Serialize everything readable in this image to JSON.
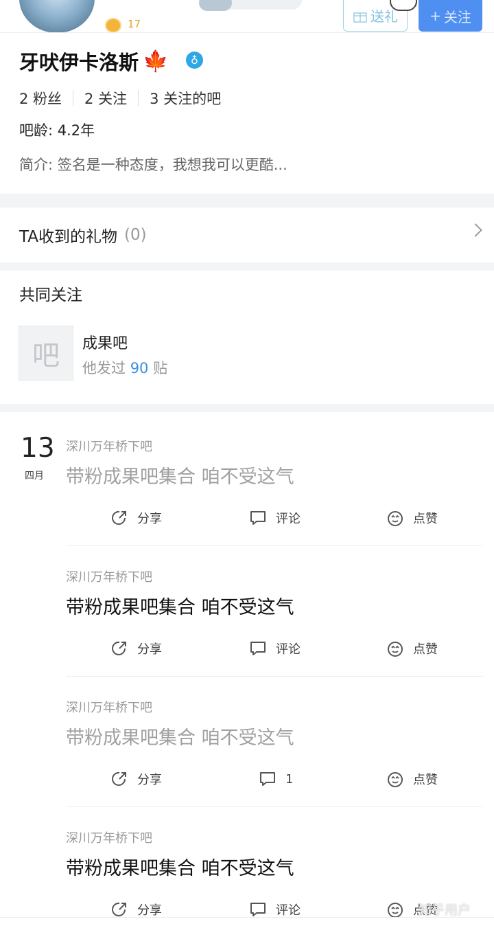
{
  "header": {
    "level": "17",
    "gift_label": "送礼",
    "follow_label": "关注",
    "follow_plus": "+"
  },
  "profile": {
    "username": "牙吠伊卡洛斯",
    "badge_emoji": "🍁",
    "verify_symbol": "♁",
    "stats": [
      {
        "label": "2 粉丝"
      },
      {
        "label": "2 关注"
      },
      {
        "label": "3 关注的吧"
      }
    ],
    "age": "吧龄: 4.2年",
    "intro": "简介: 签名是一种态度，我想我可以更酷..."
  },
  "gifts": {
    "title": "TA收到的礼物",
    "count": "(0)"
  },
  "common": {
    "title": "共同关注",
    "forum_icon_text": "吧",
    "forum_name": "成果吧",
    "posts_prefix": "他发过",
    "posts_count": "90",
    "posts_suffix": "贴"
  },
  "feed": {
    "date_day": "13",
    "date_month": "四月",
    "posts": [
      {
        "forum": "深川万年桥下吧",
        "title": "带粉成果吧集合 咱不受这气",
        "share": "分享",
        "comment": "评论",
        "like": "点赞",
        "read": true
      },
      {
        "forum": "深川万年桥下吧",
        "title": "带粉成果吧集合 咱不受这气",
        "share": "分享",
        "comment": "评论",
        "like": "点赞",
        "read": false
      },
      {
        "forum": "深川万年桥下吧",
        "title": "带粉成果吧集合 咱不受这气",
        "share": "分享",
        "comment": "1",
        "like": "点赞",
        "read": true
      },
      {
        "forum": "深川万年桥下吧",
        "title": "带粉成果吧集合 咱不受这气",
        "share": "分享",
        "comment": "评论",
        "like": "点赞",
        "read": false
      }
    ]
  },
  "watermark": "知乎用户",
  "colors": {
    "accent": "#4f8ff2",
    "link_number": "#3b8fe0",
    "gift_border": "#9fd3e6",
    "verify_badge": "#2fa7e6",
    "band": "#f3f4f6"
  }
}
